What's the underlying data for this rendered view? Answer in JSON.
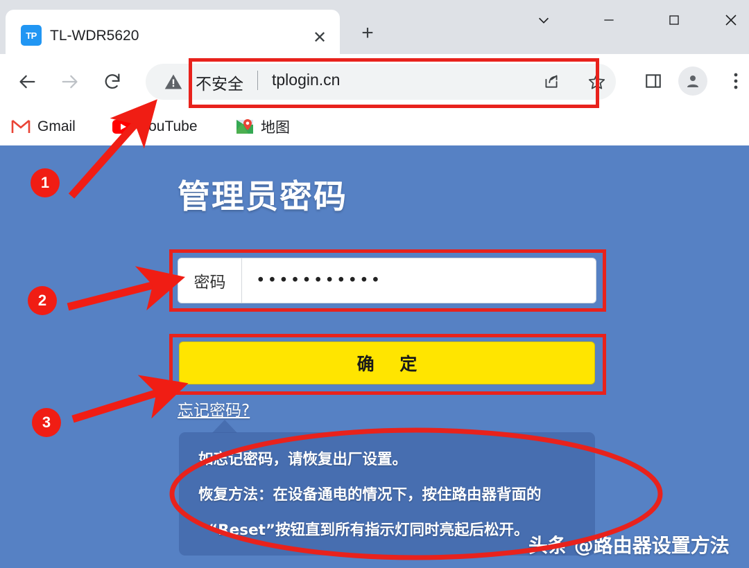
{
  "browser": {
    "tab": {
      "favicon_text": "TP",
      "favicon_name": "tplink-favicon",
      "title": "TL-WDR5620",
      "close_glyph": "✕"
    },
    "new_tab_glyph": "+",
    "window_controls": {
      "tab_search": "chevron-down-icon",
      "minimize": "minimize-icon",
      "maximize": "maximize-icon",
      "close": "close-icon"
    },
    "nav": {
      "back": "back-arrow-icon",
      "forward": "forward-arrow-icon",
      "reload": "reload-icon"
    },
    "omnibox": {
      "security_icon": "not-secure-warning-icon",
      "security_label": "不安全",
      "url": "tplogin.cn",
      "share_icon": "share-icon",
      "bookmark_icon": "star-outline-icon"
    },
    "toolbar_icons": {
      "side_panel": "side-panel-icon",
      "profile": "profile-avatar-icon",
      "menu": "three-dot-menu-icon"
    },
    "bookmarks": [
      {
        "label": "Gmail",
        "icon": "gmail-icon"
      },
      {
        "label": "YouTube",
        "icon": "youtube-icon"
      },
      {
        "label": "地图",
        "icon": "google-maps-icon"
      }
    ]
  },
  "page": {
    "title": "管理员密码",
    "password": {
      "label": "密码",
      "value": "•••••••••••",
      "placeholder": ""
    },
    "confirm_button": "确 定",
    "forgot_link": "忘记密码?",
    "info": {
      "line1": "如忘记密码，请恢复出厂设置。",
      "line2": "恢复方法：在设备通电的情况下，按住路由器背面的",
      "line3": "“Reset”按钮直到所有指示灯同时亮起后松开。"
    },
    "watermark": "头条 @路由器设置方法"
  },
  "annotations": {
    "steps": [
      "1",
      "2",
      "3"
    ],
    "highlight_color": "#e8221c",
    "circle_color": "#f01d14"
  },
  "colors": {
    "page_background": "#5681c4",
    "button_yellow": "#ffe500",
    "tab_favicon_blue": "#2196f3",
    "chrome_titlebar": "#dee1e6"
  }
}
